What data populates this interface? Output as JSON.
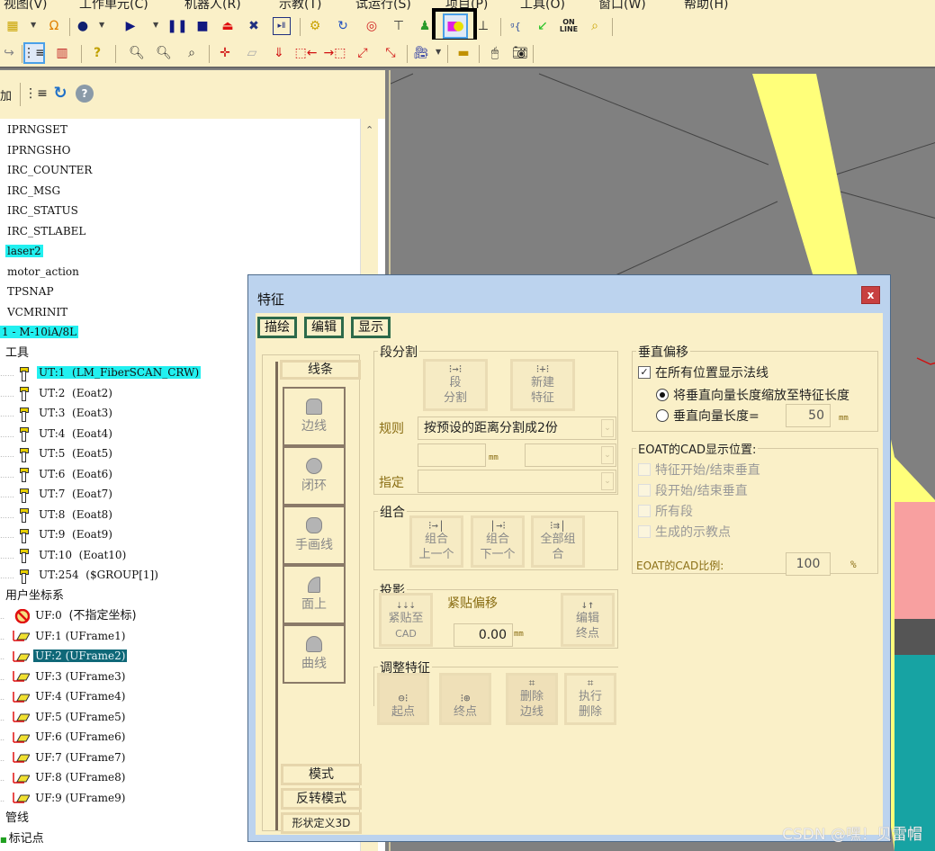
{
  "menu": {
    "items": [
      "视图(V)",
      "工作单元(C)",
      "机器人(R)",
      "示教(T)",
      "试运行(S)",
      "项目(P)",
      "工具(O)",
      "窗口(W)",
      "帮助(H)"
    ]
  },
  "toolbar1": {
    "icons": [
      "cell-browser-icon",
      "gripper-icon",
      "2d-view-icon",
      "play-icon",
      "pause-icon",
      "stop-icon",
      "eject-icon",
      "abort-icon",
      "tp-display-icon",
      "robot-move-icon",
      "jog-icon",
      "target-icon",
      "sign-icon",
      "operator-icon",
      "draw-feature-icon",
      "baseline-icon",
      "io-icon",
      "green-arrow-icon",
      "online-icon",
      "inspect-icon"
    ],
    "online_label": "ON\nLINE"
  },
  "toolbar2": {
    "icons": [
      "undo-icon",
      "tree-view-icon",
      "library-icon",
      "help-icon",
      "zoom-in-icon",
      "zoom-out-icon",
      "zoom-window-icon",
      "center-icon",
      "plane-icon",
      "drop-icon",
      "move-left-icon",
      "move-right-icon",
      "expand-icon",
      "shrink-icon",
      "camera-icon",
      "ruler-icon",
      "mouse-icon",
      "snapshot-icon"
    ]
  },
  "left_panel": {
    "toolbar_icons": [
      "add-icon",
      "tree-icon",
      "refresh-icon",
      "help-icon"
    ],
    "add_label": "加",
    "tree": {
      "programs": [
        "IPRNGSET",
        "IPRNGSHO",
        "IRC_COUNTER",
        "IRC_MSG",
        "IRC_STATUS",
        "IRC_STLABEL",
        "laser2",
        "motor_action",
        "TPSNAP",
        "VCMRINIT"
      ],
      "selected_program": "laser2",
      "robot": "1 - M-10iA/8L",
      "tools_label": "工具",
      "tools": [
        {
          "id": "UT:1",
          "name": "(LM_FiberSCAN_CRW)"
        },
        {
          "id": "UT:2",
          "name": "(Eoat2)"
        },
        {
          "id": "UT:3",
          "name": "(Eoat3)"
        },
        {
          "id": "UT:4",
          "name": "(Eoat4)"
        },
        {
          "id": "UT:5",
          "name": "(Eoat5)"
        },
        {
          "id": "UT:6",
          "name": "(Eoat6)"
        },
        {
          "id": "UT:7",
          "name": "(Eoat7)"
        },
        {
          "id": "UT:8",
          "name": "(Eoat8)"
        },
        {
          "id": "UT:9",
          "name": "(Eoat9)"
        },
        {
          "id": "UT:10",
          "name": "(Eoat10)"
        },
        {
          "id": "UT:254",
          "name": "($GROUP[1])"
        }
      ],
      "user_frames_label": "用户坐标系",
      "user_frames": [
        {
          "id": "UF:0",
          "name": "(不指定坐标)"
        },
        {
          "id": "UF:1",
          "name": "(UFrame1)"
        },
        {
          "id": "UF:2",
          "name": "(UFrame2)"
        },
        {
          "id": "UF:3",
          "name": "(UFrame3)"
        },
        {
          "id": "UF:4",
          "name": "(UFrame4)"
        },
        {
          "id": "UF:5",
          "name": "(UFrame5)"
        },
        {
          "id": "UF:6",
          "name": "(UFrame6)"
        },
        {
          "id": "UF:7",
          "name": "(UFrame7)"
        },
        {
          "id": "UF:8",
          "name": "(UFrame8)"
        },
        {
          "id": "UF:9",
          "name": "(UFrame9)"
        }
      ],
      "pipes_label": "管线",
      "markers_label": "标记点"
    }
  },
  "dialog": {
    "title": "特征",
    "close_label": "x",
    "tabs": [
      "描绘",
      "编辑",
      "显示"
    ],
    "side": {
      "header": "线条",
      "buttons": [
        "边线",
        "闭环",
        "手画线",
        "面上",
        "曲线"
      ],
      "mode_buttons": [
        "模式",
        "反转模式",
        "形状定义3D"
      ]
    },
    "segment": {
      "title": "段分割",
      "btn_split": [
        "段",
        "分割"
      ],
      "btn_new": [
        "新建",
        "特征"
      ],
      "rule_label": "规则",
      "rule_value": "按预设的距离分割成2份",
      "distance_value": "",
      "unit": "mm",
      "second_select": "",
      "specify_label": "指定",
      "specify_value": ""
    },
    "combine": {
      "title": "组合",
      "btn_prev": [
        "组合",
        "上一个"
      ],
      "btn_next": [
        "组合",
        "下一个"
      ],
      "btn_all": [
        "全部组",
        "合"
      ]
    },
    "projection": {
      "title": "投影",
      "btn_snap": [
        "紧贴至",
        "CAD"
      ],
      "offset_label": "紧贴偏移",
      "offset_value": "0.00",
      "unit": "mm",
      "btn_edit": [
        "编辑",
        "终点"
      ]
    },
    "adjust": {
      "title": "调整特征",
      "buttons": [
        "起点",
        "终点",
        "删除\n边线",
        "执行\n删除"
      ]
    },
    "normal": {
      "title": "垂直偏移",
      "show_normals_label": "在所有位置显示法线",
      "show_normals_checked": true,
      "radio_scale_label": "将垂直向量长度缩放至特征长度",
      "radio_scale_selected": true,
      "radio_length_label": "垂直向量长度=",
      "length_value": "50",
      "unit": "mm"
    },
    "eoat": {
      "title": "EOAT的CAD显示位置:",
      "options": [
        {
          "label": "特征开始/结束垂直",
          "checked": false
        },
        {
          "label": "段开始/结束垂直",
          "checked": false
        },
        {
          "label": "所有段",
          "checked": false
        },
        {
          "label": "生成的示教点",
          "checked": false
        }
      ],
      "scale_label": "EOAT的CAD比例:",
      "scale_value": "100",
      "scale_unit": "%"
    }
  },
  "watermark": "CSDN @嘿！贝雷帽",
  "colors": {
    "panel_bg": "#faf0c8",
    "selection_cyan": "#22f0f0",
    "selection_teal": "#0f6878",
    "tab_border": "#2d6a4a",
    "viewport_gray": "#808080",
    "dialog_frame": "#bcd3ee",
    "close_red": "#c84040"
  }
}
